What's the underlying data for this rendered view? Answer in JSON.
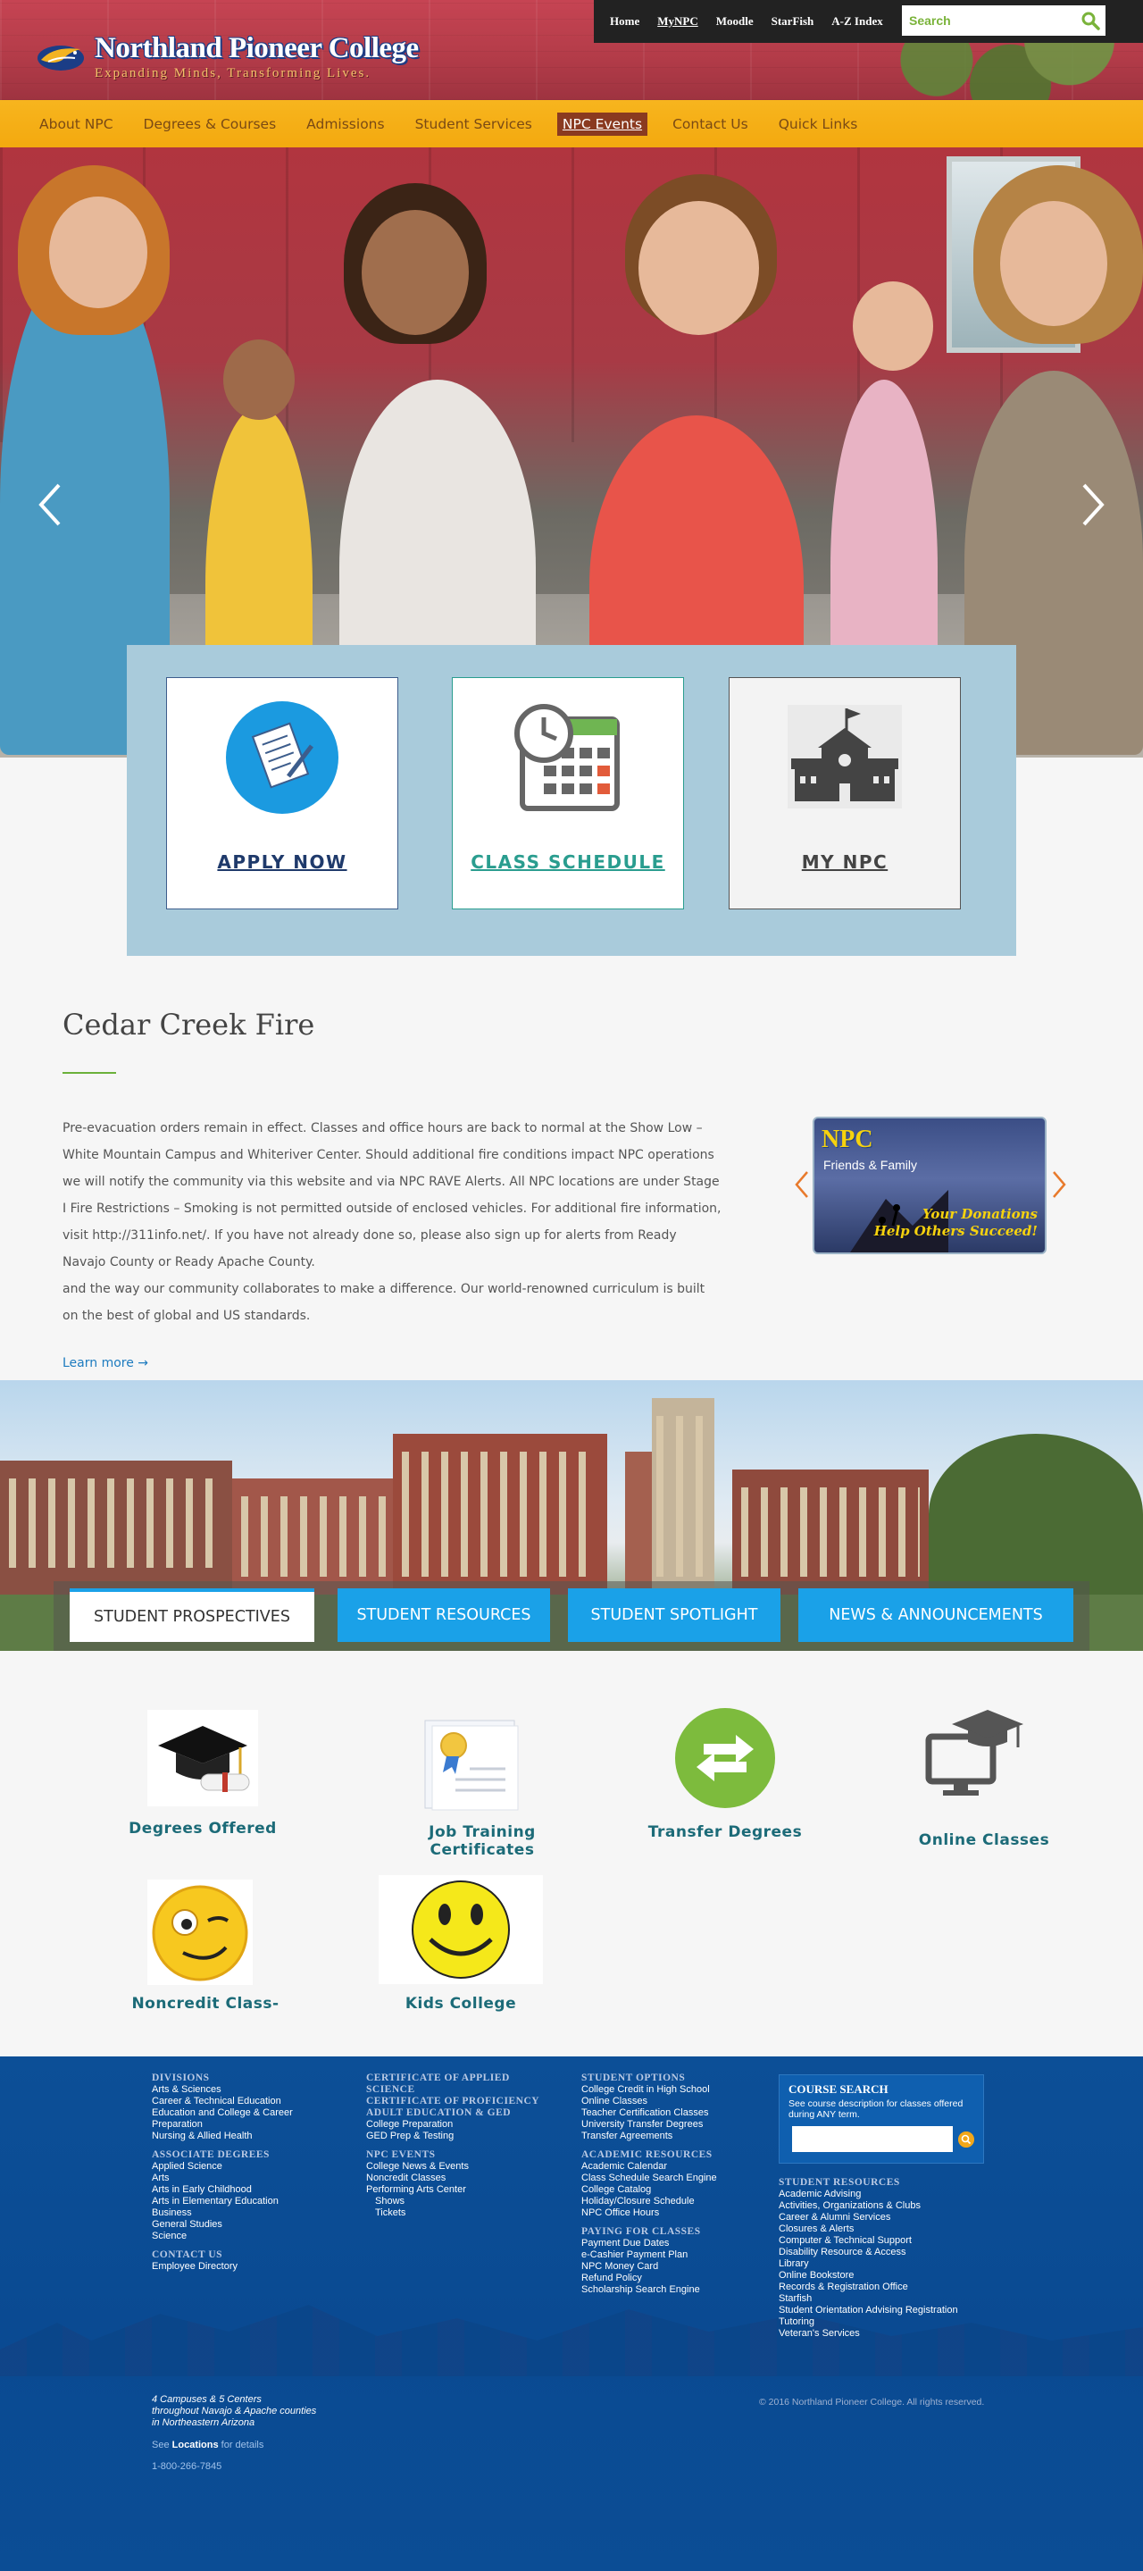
{
  "header": {
    "college_name": "Northland Pioneer College",
    "tagline": "Expanding Minds, Transforming Lives.",
    "top_nav": [
      "Home",
      "MyNPC",
      "Moodle",
      "StarFish",
      "A-Z Index"
    ],
    "search_placeholder": "Search"
  },
  "main_nav": [
    "About NPC",
    "Degrees & Courses",
    "Admissions",
    "Student Services",
    "NPC Events",
    "Contact Us",
    "Quick Links"
  ],
  "hero": {
    "quick_links": [
      "APPLY NOW",
      "CLASS SCHEDULE",
      "MY NPC"
    ]
  },
  "article": {
    "title": "Cedar Creek Fire",
    "body_1": "Pre-evacuation orders remain in effect. Classes and office hours are back to normal at the Show Low – White Mountain Campus and Whiteriver Center. Should additional fire conditions impact NPC operations we will notify the community via this website and via NPC RAVE Alerts. All NPC locations are under Stage I Fire Restrictions – Smoking is not permitted outside of enclosed vehicles. For additional fire information, visit http://311info.net/. If you have not already done so, please also sign up for alerts from Ready Navajo County or Ready Apache County.",
    "body_2": "and the way our community collaborates to make a difference. Our world-renowned curriculum is built on the best of global and US standards.",
    "learn_more": "Learn more →"
  },
  "promo": {
    "logo_text": "NPC",
    "sub_text": "Friends & Family",
    "message_1": "Your Donations",
    "message_2": "Help Others Succeed!"
  },
  "tabs": [
    "STUDENT PROSPECTIVES",
    "STUDENT RESOURCES",
    "STUDENT SPOTLIGHT",
    "NEWS & ANNOUNCEMENTS"
  ],
  "programs": {
    "degrees": "Degrees Offered",
    "job_training": "Job Training Certificates",
    "transfer": "Transfer Degrees",
    "online": "Online Classes",
    "noncredit": "Noncredit Class-",
    "kids": "Kids College"
  },
  "footer": {
    "col1": {
      "h1": "DIVISIONS",
      "divisions": [
        "Arts & Sciences",
        "Career & Technical Education",
        "Education and College & Career Preparation",
        "Nursing & Allied Health"
      ],
      "h2": "ASSOCIATE DEGREES",
      "degrees": [
        "Applied Science",
        "Arts",
        "Arts in Early Childhood",
        "Arts in Elementary Education",
        "Business",
        "General Studies",
        "Science"
      ],
      "h3": "CONTACT US",
      "contact": [
        "Employee Directory"
      ]
    },
    "col2": {
      "h1": "CERTIFICATE OF APPLIED SCIENCE",
      "h2": "CERTIFICATE OF PROFICIENCY",
      "h3": "ADULT EDUCATION & GED",
      "adult": [
        "College Preparation",
        "GED Prep & Testing"
      ],
      "h4": "NPC EVENTS",
      "events": [
        "College News & Events",
        "Noncredit Classes",
        "Performing Arts Center"
      ],
      "events_sub": [
        "Shows",
        "Tickets"
      ]
    },
    "col3": {
      "h1": "STUDENT OPTIONS",
      "options": [
        "College Credit in High School",
        "Online Classes",
        "Teacher Certification Classes",
        "University Transfer Degrees",
        "Transfer Agreements"
      ],
      "h2": "ACADEMIC RESOURCES",
      "academic": [
        "Academic Calendar",
        "Class Schedule Search Engine",
        "College Catalog",
        "Holiday/Closure Schedule",
        "NPC Office Hours"
      ],
      "h3": "PAYING FOR CLASSES",
      "paying": [
        "Payment Due Dates",
        "e-Cashier Payment Plan",
        "NPC Money Card",
        "Refund Policy",
        "Scholarship Search Engine"
      ]
    },
    "course_search": {
      "title": "COURSE SEARCH",
      "desc": "See course description for classes offered during ANY term."
    },
    "col4": {
      "h1": "STUDENT RESOURCES",
      "resources": [
        "Academic Advising",
        "Activities, Organizations & Clubs",
        "Career & Alumni Services",
        "Closures & Alerts",
        "Computer & Technical Support",
        "Disability Resource & Access",
        "Library",
        "Online Bookstore",
        "Records & Registration Office",
        "Starfish",
        "Student Orientation Advising Registration",
        "Tutoring",
        "Veteran's Services"
      ]
    },
    "campuses_1": "4 Campuses & 5 Centers",
    "campuses_2": "throughout Navajo & Apache counties",
    "campuses_3": "in Northeastern Arizona",
    "see": "See",
    "locations": "Locations",
    "for_details": "for details",
    "phone": "1-800-266-7845",
    "copyright": "© 2016 Northland Pioneer College. All rights reserved."
  },
  "colors": {
    "nav_gold": "#f3a90f",
    "tab_blue": "#1aa1e8",
    "footer_blue": "#0c4f97",
    "accent_green": "#6bb13a"
  }
}
